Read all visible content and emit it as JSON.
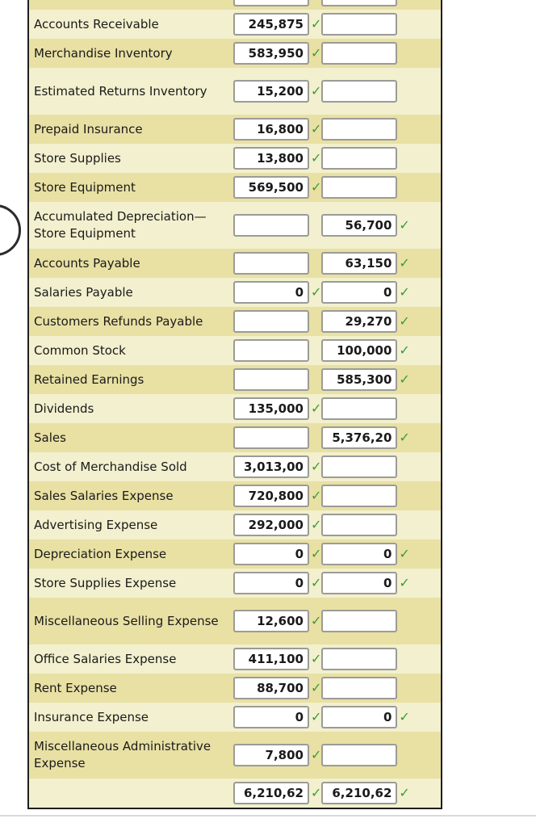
{
  "icons": {
    "check": "✓"
  },
  "colors": {
    "row_light": "#f2f0ce",
    "row_dark": "#e9e0a4",
    "check_green": "#3a9c3a",
    "table_border": "#1e1e1e",
    "input_border": "#9b9b97",
    "text": "#1a1a1a"
  },
  "worksheet": {
    "rows": [
      {
        "label": "",
        "debit": "",
        "credit": "",
        "debit_check": false,
        "credit_check": false,
        "shade": "dark",
        "clipped": true
      },
      {
        "label": "Accounts Receivable",
        "debit": "245,875",
        "credit": "",
        "debit_check": true,
        "credit_check": false,
        "shade": "light"
      },
      {
        "label": "Merchandise Inventory",
        "debit": "583,950",
        "credit": "",
        "debit_check": true,
        "credit_check": false,
        "shade": "dark"
      },
      {
        "label": "Estimated Returns Inventory",
        "debit": "15,200",
        "credit": "",
        "debit_check": true,
        "credit_check": false,
        "shade": "light",
        "tall": true
      },
      {
        "label": "Prepaid Insurance",
        "debit": "16,800",
        "credit": "",
        "debit_check": true,
        "credit_check": false,
        "shade": "dark"
      },
      {
        "label": "Store Supplies",
        "debit": "13,800",
        "credit": "",
        "debit_check": true,
        "credit_check": false,
        "shade": "light"
      },
      {
        "label": "Store Equipment",
        "debit": "569,500",
        "credit": "",
        "debit_check": true,
        "credit_check": false,
        "shade": "dark"
      },
      {
        "label": "Accumulated Depreciation—Store Equipment",
        "debit": "",
        "credit": "56,700",
        "debit_check": false,
        "credit_check": true,
        "shade": "light",
        "tall": true
      },
      {
        "label": "Accounts Payable",
        "debit": "",
        "credit": "63,150",
        "debit_check": false,
        "credit_check": true,
        "shade": "dark"
      },
      {
        "label": "Salaries Payable",
        "debit": "0",
        "credit": "0",
        "debit_check": true,
        "credit_check": true,
        "shade": "light"
      },
      {
        "label": "Customers Refunds Payable",
        "debit": "",
        "credit": "29,270",
        "debit_check": false,
        "credit_check": true,
        "shade": "dark"
      },
      {
        "label": "Common Stock",
        "debit": "",
        "credit": "100,000",
        "debit_check": false,
        "credit_check": true,
        "shade": "light"
      },
      {
        "label": "Retained Earnings",
        "debit": "",
        "credit": "585,300",
        "debit_check": false,
        "credit_check": true,
        "shade": "dark"
      },
      {
        "label": "Dividends",
        "debit": "135,000",
        "credit": "",
        "debit_check": true,
        "credit_check": false,
        "shade": "light"
      },
      {
        "label": "Sales",
        "debit": "",
        "credit": "5,376,20",
        "debit_check": false,
        "credit_check": true,
        "shade": "dark"
      },
      {
        "label": "Cost of Merchandise Sold",
        "debit": "3,013,00",
        "credit": "",
        "debit_check": true,
        "credit_check": false,
        "shade": "light"
      },
      {
        "label": "Sales Salaries Expense",
        "debit": "720,800",
        "credit": "",
        "debit_check": true,
        "credit_check": false,
        "shade": "dark"
      },
      {
        "label": "Advertising Expense",
        "debit": "292,000",
        "credit": "",
        "debit_check": true,
        "credit_check": false,
        "shade": "light"
      },
      {
        "label": "Depreciation Expense",
        "debit": "0",
        "credit": "0",
        "debit_check": true,
        "credit_check": true,
        "shade": "dark"
      },
      {
        "label": "Store Supplies Expense",
        "debit": "0",
        "credit": "0",
        "debit_check": true,
        "credit_check": true,
        "shade": "light"
      },
      {
        "label": "Miscellaneous Selling Expense",
        "debit": "12,600",
        "credit": "",
        "debit_check": true,
        "credit_check": false,
        "shade": "dark",
        "tall": true
      },
      {
        "label": "Office Salaries Expense",
        "debit": "411,100",
        "credit": "",
        "debit_check": true,
        "credit_check": false,
        "shade": "light"
      },
      {
        "label": "Rent Expense",
        "debit": "88,700",
        "credit": "",
        "debit_check": true,
        "credit_check": false,
        "shade": "dark"
      },
      {
        "label": "Insurance Expense",
        "debit": "0",
        "credit": "0",
        "debit_check": true,
        "credit_check": true,
        "shade": "light"
      },
      {
        "label": "Miscellaneous Administrative Expense",
        "debit": "7,800",
        "credit": "",
        "debit_check": true,
        "credit_check": false,
        "shade": "dark",
        "tall": true
      },
      {
        "label": "",
        "debit": "6,210,62",
        "credit": "6,210,62",
        "debit_check": true,
        "credit_check": true,
        "shade": "light",
        "totals": true
      }
    ]
  }
}
